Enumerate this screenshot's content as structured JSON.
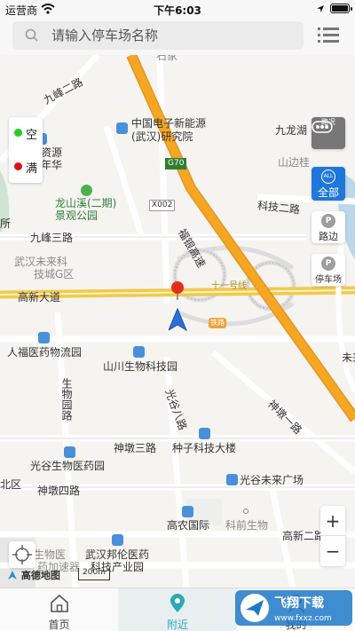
{
  "status_bar": {
    "carrier": "运营商",
    "time": "下午6:03"
  },
  "search": {
    "placeholder": "请输入停车场名称"
  },
  "legend": {
    "empty_label": "空",
    "full_label": "满",
    "empty_color": "#22cc22",
    "full_color": "#dd1111"
  },
  "controls": {
    "traffic_label": "路况",
    "all_icon_text": "ALL",
    "all_label": "全部",
    "roadside_label": "路边",
    "parking_label": "停车场",
    "zoom_in": "+",
    "zoom_out": "−",
    "p_glyph": "P"
  },
  "map": {
    "labels": {
      "jiufeng2": "九峰二路",
      "cetc1": "中国电子新能源",
      "cetc2": "(武汉)研究院",
      "jiulong": "九龙湖",
      "beida1": "北大资源",
      "beida2": "山水年华",
      "shanbian": "山边桂",
      "longshan1": "龙山溪(二期)",
      "longshan2": "景观公园",
      "keji2": "科技二路",
      "jiufeng3": "九峰三路",
      "weilai1": "武汉未来科",
      "weilai2": "技城G区",
      "gaoxin": "高新大道",
      "renfu": "人福医药物流园",
      "shanchuan": "山川生物科技园",
      "shengwu": "生物园路",
      "guanggu8": "光谷八路",
      "shendun1": "神墩一路",
      "shendun3": "神墩三路",
      "zhongzi": "种子科技大楼",
      "guanggu_bio": "光谷生物医药园",
      "shendun4": "神墩四路",
      "weilai_plaza": "光谷未来广场",
      "gaonong": "高农国际",
      "keqian": "科前生物",
      "gaoxin2": "高新二路",
      "accel1": "光谷生物医",
      "accel2": "药加速器",
      "bangning1": "武汉邦伦医药",
      "bangning2": "科技产业园",
      "beiqu": "北区",
      "suo": "所",
      "wei": "未来",
      "shijia": "石家",
      "fuyin": "福银高速",
      "line11": "十一号线",
      "g70": "G70",
      "x002": "X002",
      "tiezhan": "铁路"
    },
    "attribution": "高德地图",
    "scale": "200m"
  },
  "tabs": [
    {
      "label": "首页",
      "icon": "home-icon",
      "active": false
    },
    {
      "label": "附近",
      "icon": "location-pin-icon",
      "active": true
    },
    {
      "label": "我的",
      "icon": "user-icon",
      "active": false
    }
  ],
  "watermark": {
    "text": "飞翔下载",
    "url": "www.fxxz.com"
  },
  "colors": {
    "accent": "#2ca9b6",
    "highway": "#f5a623",
    "expressway": "#f2c94c",
    "all_button": "#1e78d9"
  }
}
